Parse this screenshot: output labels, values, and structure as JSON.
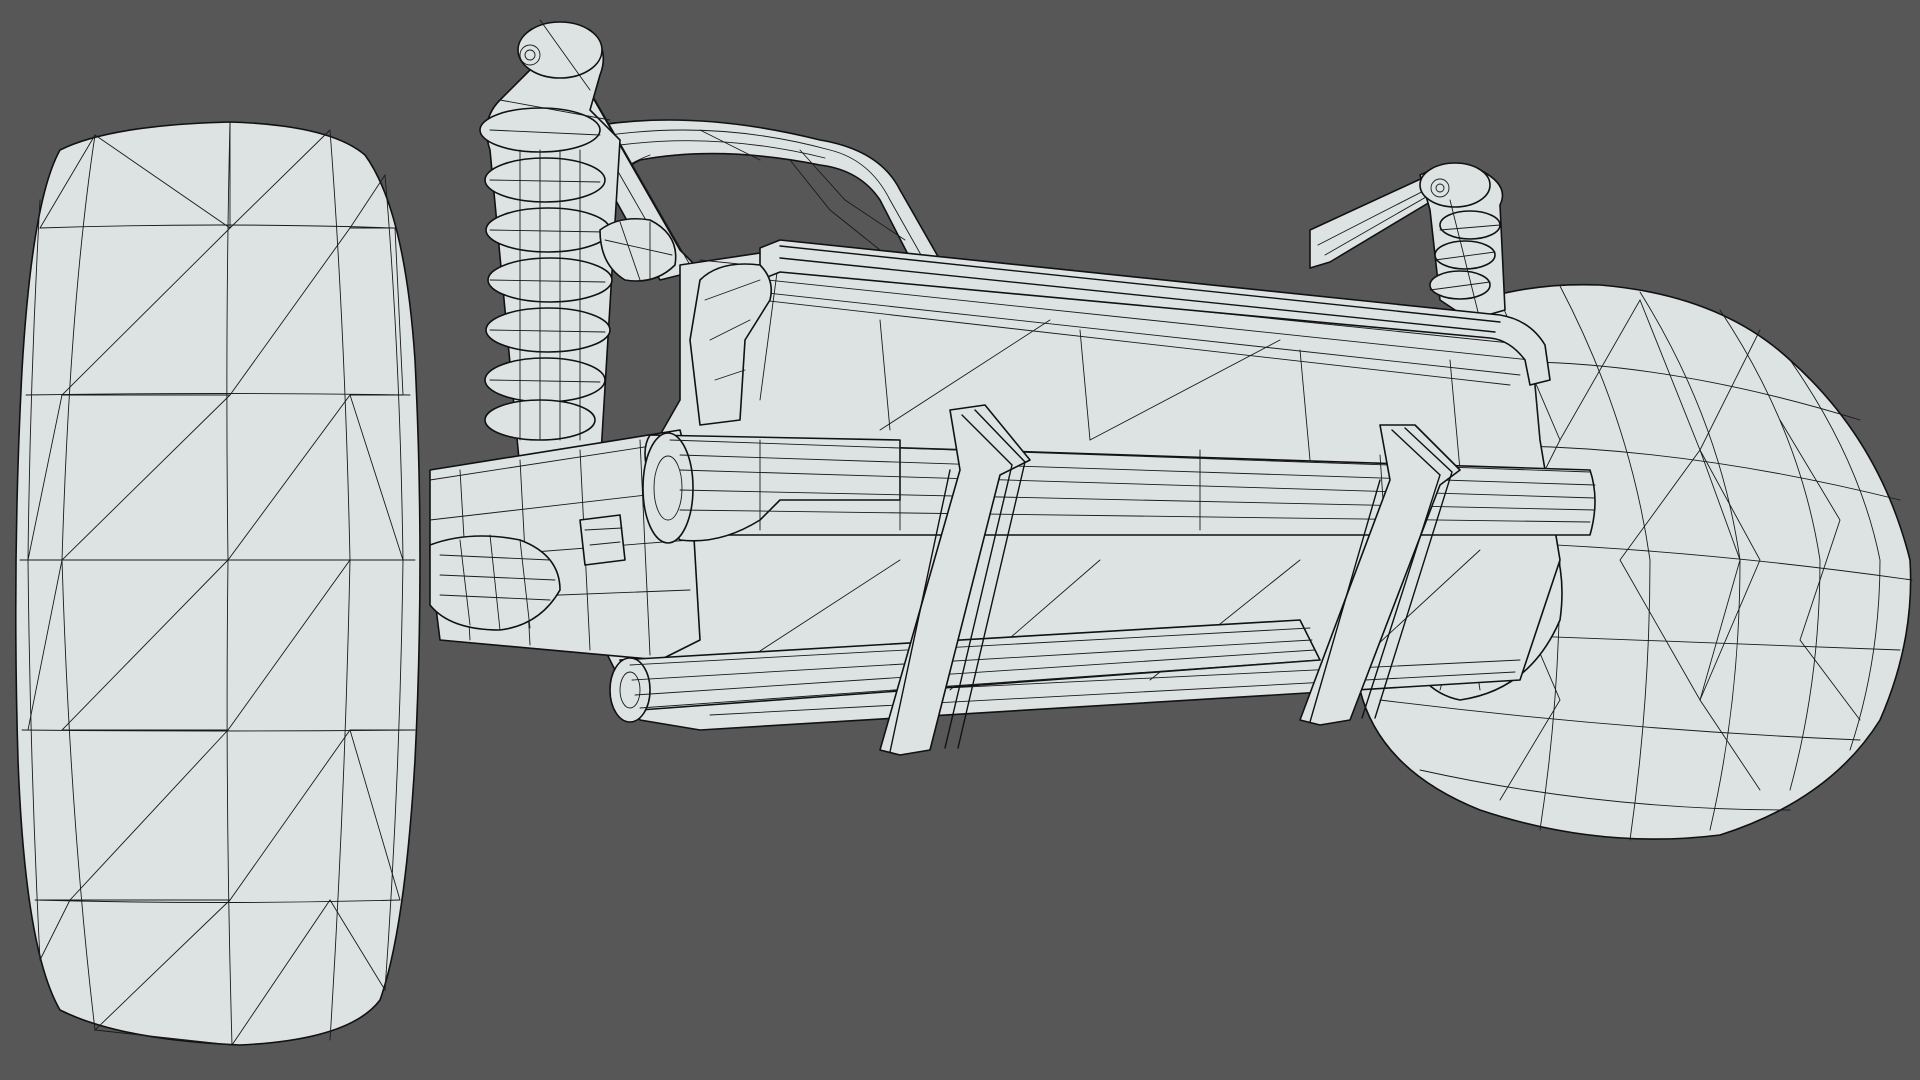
{
  "viewport": {
    "background_color": "#575757",
    "mesh_fill_color": "#dde3e3",
    "wire_color": "#111111",
    "display_mode": "wireframe-on-shaded"
  },
  "model": {
    "parts": [
      {
        "id": "left-wheel",
        "icon": "wheel-icon"
      },
      {
        "id": "right-wheel",
        "icon": "wheel-icon"
      },
      {
        "id": "body",
        "icon": "cylinder-icon"
      },
      {
        "id": "roll-bar",
        "icon": "frame-icon"
      },
      {
        "id": "left-shock-absorber",
        "icon": "spring-icon"
      },
      {
        "id": "right-shock-absorber",
        "icon": "spring-icon"
      },
      {
        "id": "axle",
        "icon": "axle-icon"
      }
    ]
  }
}
